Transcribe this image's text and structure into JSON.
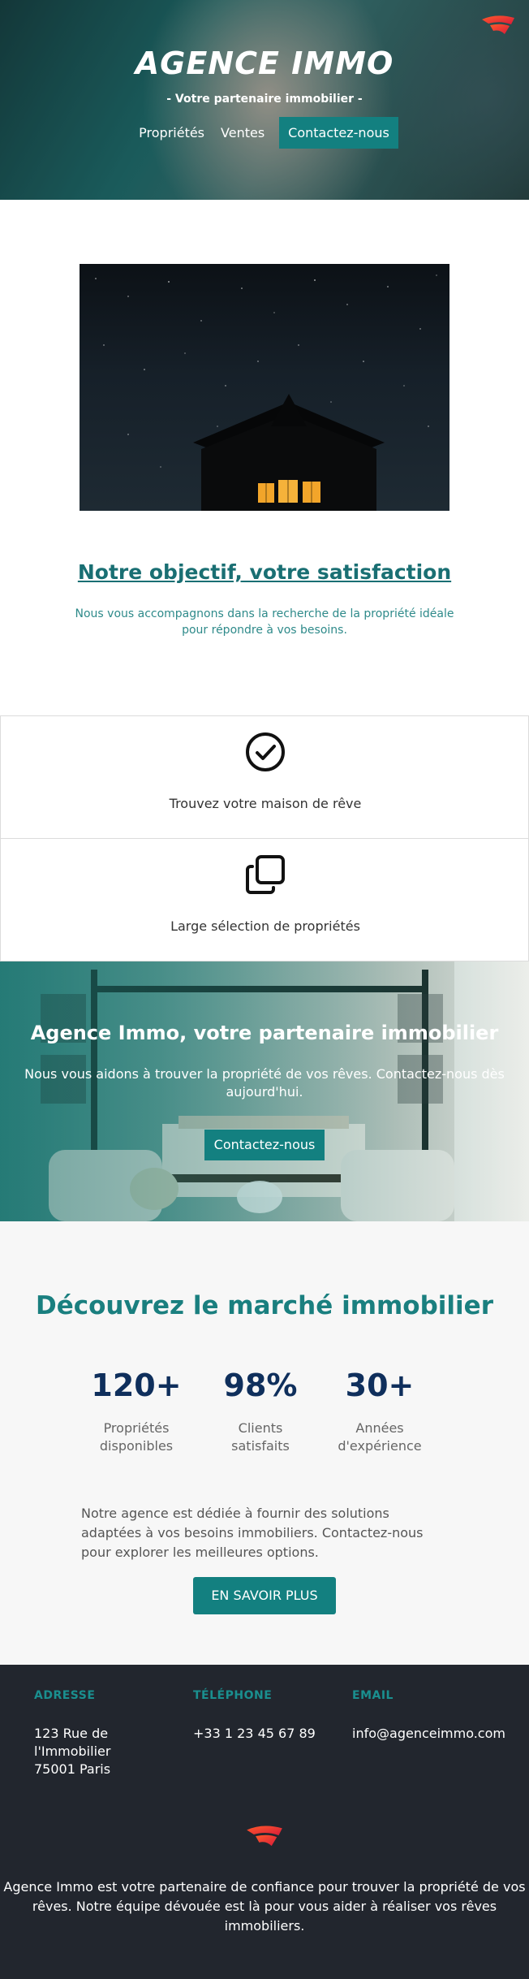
{
  "hero": {
    "title": "AGENCE IMMO",
    "tagline": "- Votre partenaire immobilier -",
    "nav": [
      {
        "label": "Propriétés"
      },
      {
        "label": "Ventes"
      },
      {
        "label": "Contactez-nous"
      }
    ],
    "logo_icon": "brand-logo-icon"
  },
  "objective": {
    "title": "Notre objectif, votre satisfaction",
    "text": "Nous vous accompagnons dans la recherche de la propriété idéale pour répondre à vos besoins."
  },
  "features": [
    {
      "icon": "check-circle-icon",
      "label": "Trouvez votre maison de rêve"
    },
    {
      "icon": "copy-squares-icon",
      "label": "Large sélection de propriétés"
    }
  ],
  "banner": {
    "title": "Agence Immo, votre partenaire immobilier",
    "text": "Nous vous aidons à trouver la propriété de vos rêves. Contactez-nous dès aujourd'hui.",
    "button": "Contactez-nous"
  },
  "market": {
    "title": "Découvrez le marché immobilier",
    "stats": [
      {
        "value": "120+",
        "caption": "Propriétés disponibles"
      },
      {
        "value": "98%",
        "caption": "Clients satisfaits"
      },
      {
        "value": "30+",
        "caption": "Années d'expérience"
      }
    ],
    "description": "Notre agence est dédiée à fournir des solutions adaptées à vos besoins immobiliers. Contactez-nous pour explorer les meilleures options.",
    "button": "EN SAVOIR PLUS"
  },
  "footer": {
    "address_label": "ADRESSE",
    "address_value": "123 Rue de l'Immobilier 75001 Paris",
    "phone_label": "TÉLÉPHONE",
    "phone_value": "+33 1 23 45 67 89",
    "email_label": "EMAIL",
    "email_value": "info@agenceimmo.com",
    "about": "Agence Immo est votre partenaire de confiance pour trouver la propriété de vos rêves. Notre équipe dévouée est là pour vous aider à réaliser vos rêves immobiliers."
  },
  "colors": {
    "accent": "#138080",
    "heading_teal": "#1a7f7f",
    "stat_navy": "#0f2f5c",
    "footer_bg": "#22262e"
  }
}
